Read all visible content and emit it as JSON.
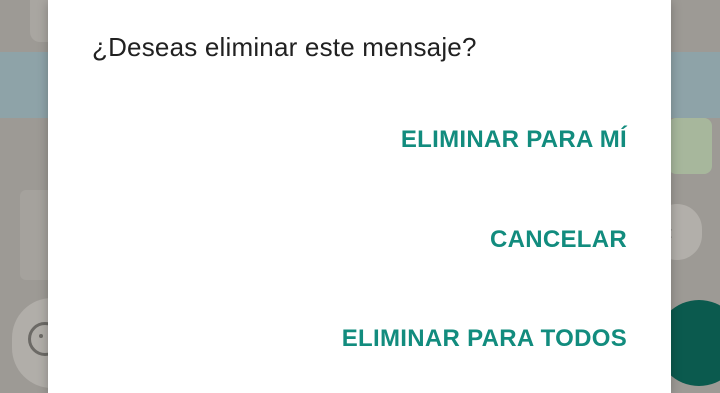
{
  "dialog": {
    "title": "¿Deseas eliminar este mensaje?",
    "actions": {
      "delete_for_me": "ELIMINAR PARA MÍ",
      "cancel": "CANCELAR",
      "delete_for_everyone": "ELIMINAR PARA TODOS"
    }
  },
  "colors": {
    "accent": "#128c7e",
    "scrim": "#9d9a95",
    "dialog_background": "#ffffff",
    "title_text": "#212121",
    "fab": "#0b5a4e"
  },
  "icons": {
    "emoji": "emoji-icon",
    "reply": "reply-icon",
    "mic": "mic-button"
  }
}
